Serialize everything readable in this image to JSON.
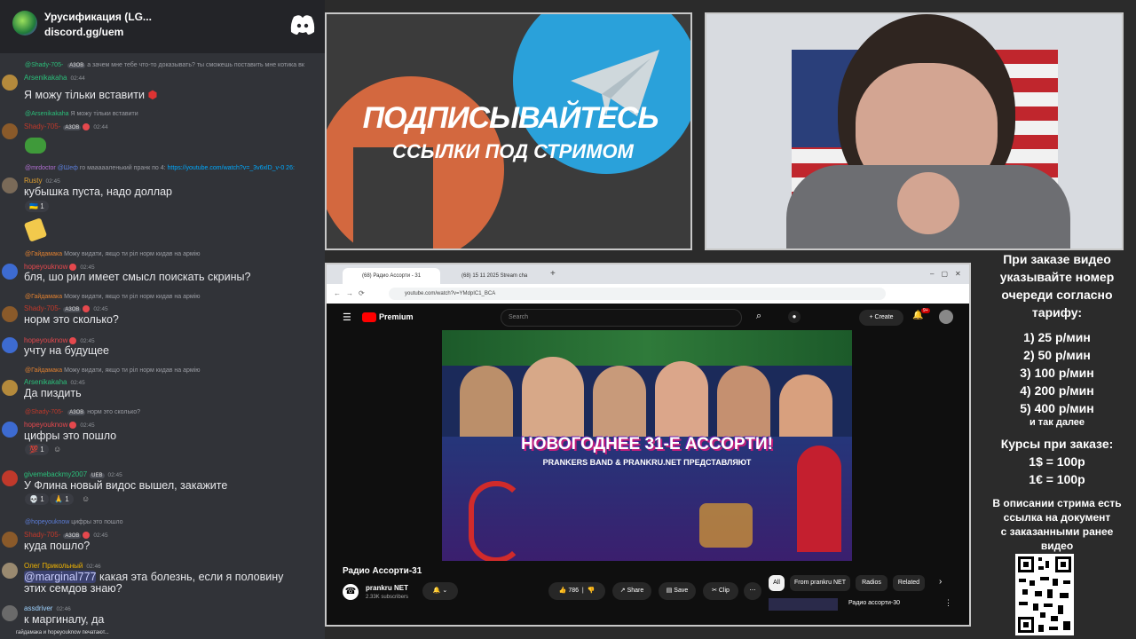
{
  "server": {
    "name": "Урусификация (LG...",
    "link": "discord.gg/uem"
  },
  "chat": [
    {
      "reply_user": "@Shady-705-",
      "reply_tag": "A3OB",
      "reply_text": "а зачем мне тебе что-то доказывать? ты сможешь поставить мне котика вк",
      "user": "Arsenikakaha",
      "time": "02:44",
      "text": "Я можу тільки вставити"
    },
    {
      "reply_user": "@Arsenikakaha",
      "reply_text": "Я можу тільки вставити",
      "user": "Shady-705-",
      "tag": "A3OB",
      "time": "02:44",
      "text": ""
    },
    {
      "reply_user": "@mrdoctor",
      "reply_mention": "@Шеф",
      "reply_text": "го маааааленький пранк по 4:",
      "reply_link": "https://youtube.com/watch?v=_3v6xlD_v-0 26:",
      "user": "Rusty",
      "time": "02:45",
      "text": "кубышка пуста, надо доллар",
      "reaction_count": "1"
    },
    {
      "reply_user": "@Гайдамака",
      "reply_text": "Можу видати, якщо ти рiл норм кидав на армiю",
      "user": "hopeyouknow",
      "time": "02:45",
      "text": "бля, шо рил имеет смысл поискать скрины?"
    },
    {
      "reply_user": "@Гайдамака",
      "reply_text": "Можу видати, якщо ти рiл норм кидав на армiю",
      "user": "Shady-705-",
      "tag": "A3OB",
      "time": "02:45",
      "text": "норм это сколько?"
    },
    {
      "user": "hopeyouknow",
      "time": "02:45",
      "text": "учту на будущее"
    },
    {
      "reply_user": "@Гайдамака",
      "reply_text": "Можу видати, якщо ти рiл норм кидав на армiю",
      "user": "Arsenikakaha",
      "time": "02:45",
      "text": "Да пиздить"
    },
    {
      "reply_user": "@Shady-705-",
      "reply_tag": "A3OB",
      "reply_text": "норм это сколько?",
      "user": "hopeyouknow",
      "time": "02:45",
      "text": "цифры это пошло",
      "reaction_count": "1"
    },
    {
      "user": "givemebackmy2007",
      "tag": "UEB",
      "time": "02:45",
      "text": "У Флина новый видос вышел, закажите",
      "reaction_counts": [
        "1",
        "1"
      ]
    },
    {
      "reply_user": "@hopeyouknow",
      "reply_text": "цифры это пошло",
      "user": "Shady-705-",
      "tag": "A3OB",
      "time": "02:45",
      "text": "куда пошло?"
    },
    {
      "user": "Олег Прикольный",
      "time": "02:46",
      "mention": "@marginal777",
      "text": " какая эта болезнь, если я половину",
      "text2": "этих семдов знаю?"
    },
    {
      "user": "assdriver",
      "time": "02:46",
      "text": "к маргиналу, да"
    }
  ],
  "typing": "гайдамака и hopeyouknow печатают...",
  "banner": {
    "line1": "ПОДПИСЫВАЙТЕСЬ",
    "line2": "ССЫЛКИ ПОД СТРИМОМ"
  },
  "browser": {
    "tabs": [
      "(68) Радио Ассорти - 31",
      "(68) 15 11 2025 Stream cha"
    ],
    "url": "youtube.com/watch?v=YMdpIC1_BCA",
    "yt_logo": "Premium",
    "search_placeholder": "Search",
    "create": "Create",
    "notif_count": "9+",
    "thumb_title": "НОВОГОДНЕЕ 31-Е АССОРТИ!",
    "thumb_subtitle": "PRANKERS BAND & PRANKRU.NET ПРЕДСТАВЛЯЮТ",
    "video_title": "Радио Ассорти-31",
    "channel": "prankru NET",
    "subscribers": "2.33K subscribers",
    "likes": "786",
    "share": "Share",
    "save": "Save",
    "clip": "Clip",
    "chips": [
      "All",
      "From prankru NET",
      "Radios",
      "Related"
    ],
    "next_video": "Радио ассорти-30"
  },
  "info": {
    "intro": [
      "При заказе видео",
      "указывайте номер",
      "очереди согласно",
      "тарифу:"
    ],
    "rates": [
      "1) 25 р/мин",
      "2) 50 р/мин",
      "3) 100 р/мин",
      "4) 200 р/мин",
      "5) 400 р/мин"
    ],
    "rates_more": "и так далее",
    "courses_title": "Курсы при заказе:",
    "courses": [
      "1$ = 100р",
      "1€ = 100р"
    ],
    "desc": [
      "В описании стрима есть",
      "ссылка на документ",
      "с заказанными ранее",
      "видео"
    ]
  },
  "colors": {
    "chat_bg": "#313338",
    "header_bg": "#232428",
    "accent_green": "#2bbf7a",
    "youtube_red": "#ff0000"
  }
}
